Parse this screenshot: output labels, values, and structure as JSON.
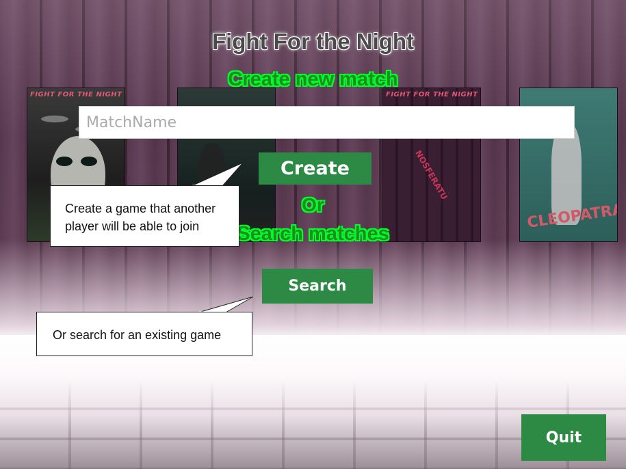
{
  "title": "Fight For the Night",
  "create_heading": "Create new match",
  "input": {
    "placeholder": "MatchName",
    "value": ""
  },
  "create_button": "Create",
  "or_text": "Or",
  "search_heading": "Search matches",
  "search_button": "Search",
  "quit_button": "Quit",
  "callouts": {
    "create": "Create a game that another player will be able to join",
    "search": "Or search for an existing game"
  },
  "posters": [
    {
      "title": "FIGHT FOR THE NIGHT"
    },
    {
      "title": ""
    },
    {
      "title": "FIGHT FOR THE NIGHT",
      "text": "NOSFERATU"
    },
    {
      "title": "",
      "text": "CLEOPATRA"
    }
  ],
  "colors": {
    "button": "#2c8a45",
    "heading_green": "#1e8f1e",
    "heading_glow": "#00ff2a"
  }
}
